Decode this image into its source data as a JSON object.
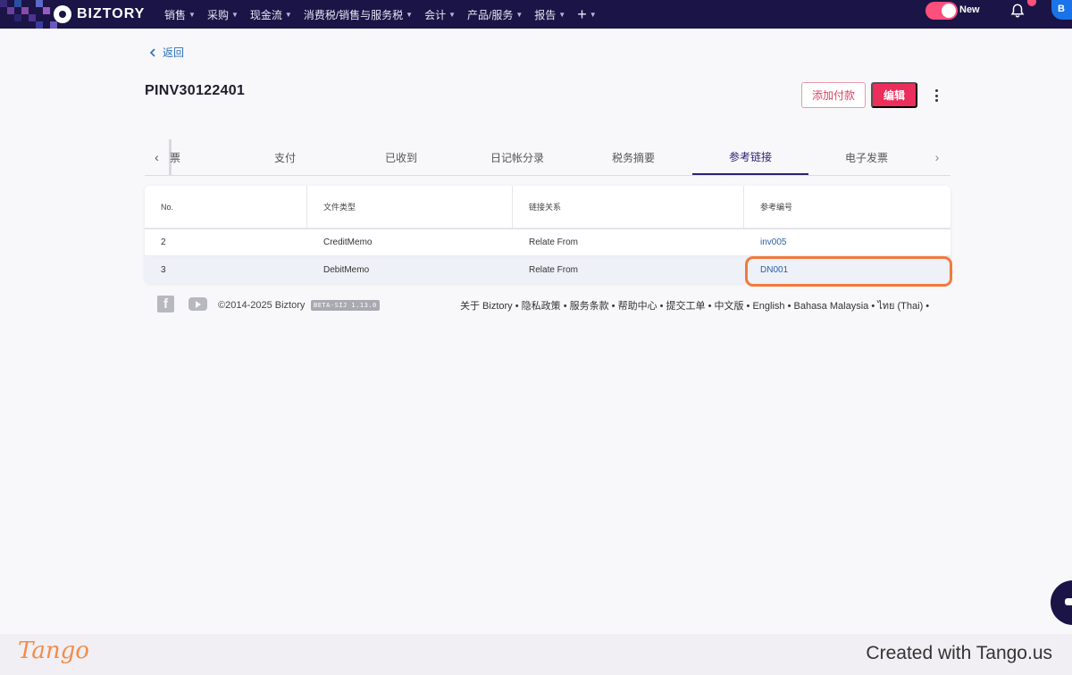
{
  "topnav": {
    "brand": "BIZTORY",
    "menu": [
      {
        "label": "销售"
      },
      {
        "label": "采购"
      },
      {
        "label": "现金流"
      },
      {
        "label": "消费税/销售与服务税"
      },
      {
        "label": "会计"
      },
      {
        "label": "产品/服务"
      },
      {
        "label": "报告"
      }
    ],
    "plus": "+",
    "toggle_label": "New",
    "avatar_initial": "B",
    "accent_color": "#ff4f7b",
    "nav_color": "#1b1446"
  },
  "back_label": "返回",
  "page_title": "PINV30122401",
  "actions": {
    "add_payment": "添加付款",
    "edit": "编辑"
  },
  "tabs": {
    "items": [
      "票",
      "支付",
      "已收到",
      "日记帐分录",
      "税务摘要",
      "参考链接",
      "电子发票"
    ],
    "active": "参考链接"
  },
  "table": {
    "headers": [
      "No.",
      "文件类型",
      "链接关系",
      "参考编号"
    ],
    "rows": [
      {
        "no": "2",
        "type": "CreditMemo",
        "relation": "Relate From",
        "ref": "inv005"
      },
      {
        "no": "3",
        "type": "DebitMemo",
        "relation": "Relate From",
        "ref": "DN001"
      }
    ]
  },
  "footer": {
    "copyright": "©2014-2025 Biztory",
    "beta": "BETA-SIJ 1.13.0",
    "links": "关于 Biztory • 隐私政策 • 服务条款 • 帮助中心 • 提交工单 • 中文版 • English • Bahasa Malaysia • ไทย (Thai) •"
  },
  "tango": {
    "logo": "Tango",
    "credit": "Created with Tango.us",
    "highlight_color": "#f2793b"
  }
}
